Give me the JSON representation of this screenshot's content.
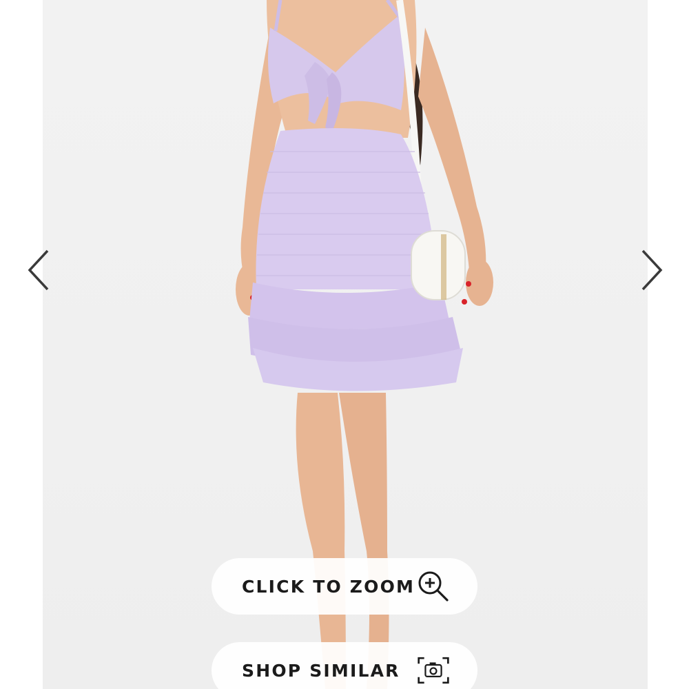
{
  "viewer": {
    "prev_icon": "chevron-left-icon",
    "next_icon": "chevron-right-icon",
    "zoom_button": {
      "label": "CLICK TO ZOOM",
      "icon": "zoom-in-icon"
    },
    "similar_button": {
      "label": "SHOP SIMILAR",
      "icon": "camera-icon"
    }
  },
  "colors": {
    "dress": "#d6c8ec",
    "backdrop": "#f0f0f0",
    "nails": "#d8232a"
  }
}
